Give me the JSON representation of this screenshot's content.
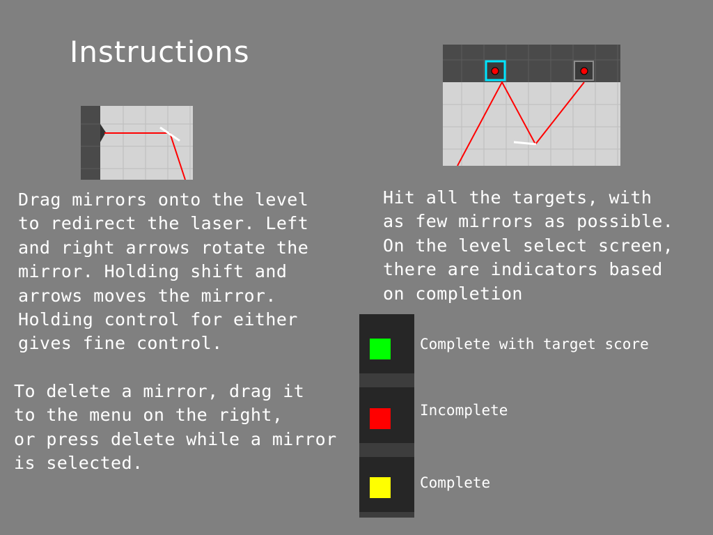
{
  "title": "Instructions",
  "instructions": {
    "mirrors_text": "Drag mirrors onto the level\nto redirect the laser. Left\nand right arrows rotate the\nmirror. Holding shift and\narrows moves the mirror.\nHolding control for either\ngives fine control.",
    "delete_text": "To delete a mirror, drag it\nto the menu on the right,\nor press delete while a mirror\nis selected.",
    "targets_text": "Hit all the targets, with\nas few mirrors as possible.\nOn the level select screen,\nthere are indicators based\non completion"
  },
  "legend": [
    {
      "label": "Complete with target score",
      "color": "#00ff00"
    },
    {
      "label": "Incomplete",
      "color": "#ff0000"
    },
    {
      "label": "Complete",
      "color": "#ffff00"
    }
  ],
  "colors": {
    "background": "#808080",
    "laser": "#ff0000",
    "grid_floor": "#d4d4d4",
    "wall": "#4a4a4a",
    "selected_target_outline": "#00e5ff"
  }
}
